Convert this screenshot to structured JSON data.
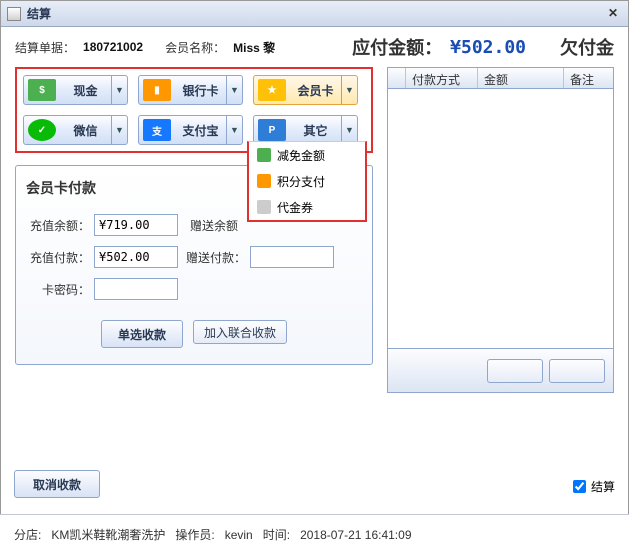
{
  "window": {
    "title": "结算",
    "close": "✕"
  },
  "info": {
    "order_label": "结算单据：",
    "order_value": "180721002",
    "member_label": "会员名称：",
    "member_value": "Miss 黎",
    "due_label": "应付金额：",
    "due_value": "¥502.00",
    "owe_label": "欠付金"
  },
  "paymethods": {
    "cash": "现金",
    "bank": "银行卡",
    "card": "会员卡",
    "wechat": "微信",
    "alipay": "支付宝",
    "other": "其它"
  },
  "other_menu": {
    "reduce": "减免金额",
    "points": "积分支付",
    "voucher": "代金券"
  },
  "detail": {
    "title": "会员卡付款",
    "balance_label": "充值余额：",
    "balance_value": "¥719.00",
    "bonus_balance_label": "赠送余额",
    "pay_label": "充值付款：",
    "pay_value": "¥502.00",
    "bonus_pay_label": "赠送付款：",
    "pwd_label": "卡密码：",
    "btn_single": "单选收款",
    "btn_union": "加入联合收款"
  },
  "table": {
    "col_blank": "",
    "col_method": "付款方式",
    "col_amount": "金额",
    "col_note": "备注"
  },
  "actions": {
    "cancel": "取消收款",
    "checkbox": "结算"
  },
  "status": {
    "shop_label": "分店:",
    "shop_value": "KM凯米鞋靴潮奢洗护",
    "op_label": "操作员:",
    "op_value": "kevin",
    "time_label": "时间:",
    "time_value": "2018-07-21 16:41:09"
  }
}
